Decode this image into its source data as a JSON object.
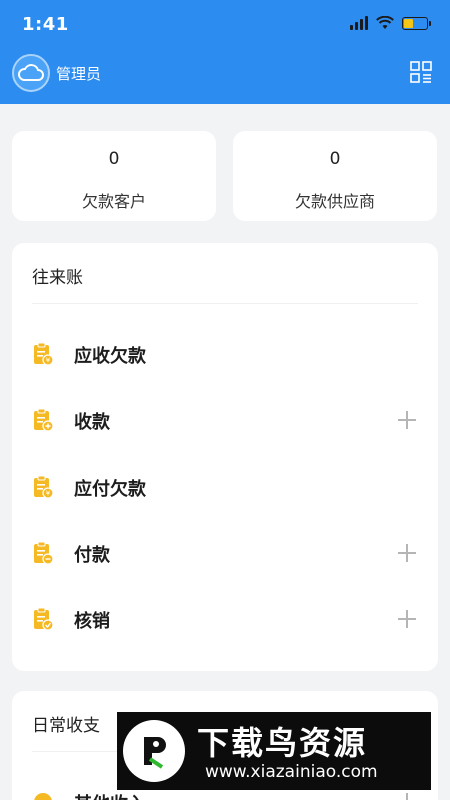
{
  "status_bar": {
    "time": "1:41"
  },
  "app_bar": {
    "user_name": "管理员"
  },
  "summary": [
    {
      "value": "0",
      "label": "欠款客户"
    },
    {
      "value": "0",
      "label": "欠款供应商"
    }
  ],
  "accounts_card": {
    "title": "往来账",
    "items": [
      {
        "label": "应收欠款",
        "icon": "clipboard-yen-icon",
        "has_add": false
      },
      {
        "label": "收款",
        "icon": "clipboard-plus-icon",
        "has_add": true
      },
      {
        "label": "应付欠款",
        "icon": "clipboard-yen-icon",
        "has_add": false
      },
      {
        "label": "付款",
        "icon": "clipboard-minus-icon",
        "has_add": true
      },
      {
        "label": "核销",
        "icon": "clipboard-check-icon",
        "has_add": true
      }
    ]
  },
  "daily_card": {
    "title": "日常收支",
    "items": [
      {
        "label": "其他收入",
        "icon": "circle-icon",
        "has_add": true
      }
    ]
  },
  "watermark": {
    "title": "下载鸟资源",
    "url": "www.xiazainiao.com"
  },
  "colors": {
    "primary": "#2d8cf0",
    "icon_accent": "#f5b923",
    "background": "#f2f3f5"
  }
}
